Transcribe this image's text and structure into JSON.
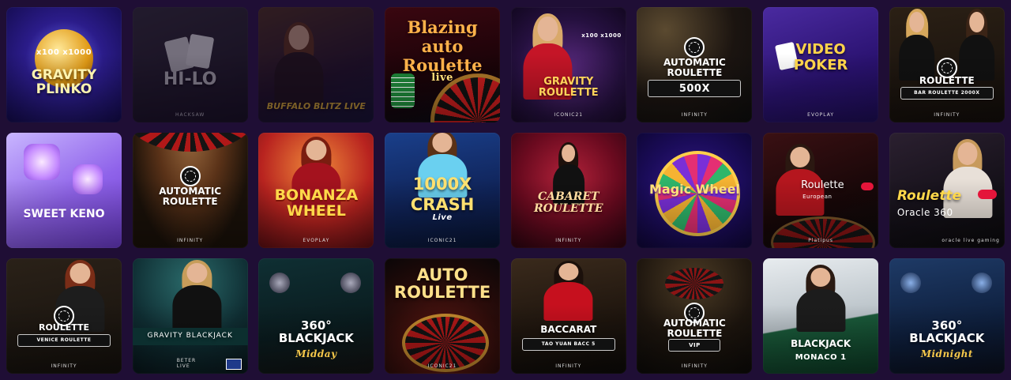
{
  "tiles": [
    {
      "title": "GRAVITY PLINKO",
      "subtitle": "x100  x1000",
      "provider": ""
    },
    {
      "title": "HI-LO",
      "subtitle": "",
      "provider": "HACKSAW"
    },
    {
      "title": "BUFFALO BLITZ LIVE",
      "subtitle": "",
      "provider": ""
    },
    {
      "title": "Blazing auto Roulette",
      "subtitle": "live",
      "provider": ""
    },
    {
      "title": "GRAVITY ROULETTE",
      "subtitle": "x100  x1000",
      "provider": "ICONIC21"
    },
    {
      "title": "AUTOMATIC ROULETTE",
      "subtitle": "500X",
      "provider": "INFINITY"
    },
    {
      "title": "VIDEO POKER",
      "subtitle": "",
      "provider": "EVOPLAY"
    },
    {
      "title": "ROULETTE",
      "subtitle": "BAR ROULETTE 2000X",
      "provider": "INFINITY"
    },
    {
      "title": "SWEET KENO",
      "subtitle": "",
      "provider": ""
    },
    {
      "title": "AUTOMATIC ROULETTE",
      "subtitle": "",
      "provider": "INFINITY"
    },
    {
      "title": "BONANZA WHEEL",
      "subtitle": "",
      "provider": "EVOPLAY"
    },
    {
      "title": "1000X CRASH",
      "subtitle": "Live",
      "provider": "ICONIC21"
    },
    {
      "title": "CABARET ROULETTE",
      "subtitle": "",
      "provider": "INFINITY"
    },
    {
      "title": "Magic Wheel",
      "subtitle": "",
      "provider": ""
    },
    {
      "title": "Roulette",
      "subtitle": "European",
      "provider": "Platipus"
    },
    {
      "title": "Roulette",
      "subtitle": "Oracle 360",
      "provider": "oracle live gaming"
    },
    {
      "title": "ROULETTE",
      "subtitle": "VENICE  ROULETTE",
      "provider": "INFINITY"
    },
    {
      "title": "GRAVITY BLACKJACK",
      "subtitle": "",
      "provider": "BETER LIVE"
    },
    {
      "title": "360° BLACKJACK",
      "subtitle": "Midday",
      "provider": ""
    },
    {
      "title": "AUTO ROULETTE",
      "subtitle": "",
      "provider": "ICONIC21"
    },
    {
      "title": "BACCARAT",
      "subtitle": "TAO YUAN  BACC 5",
      "provider": "INFINITY"
    },
    {
      "title": "AUTOMATIC ROULETTE",
      "subtitle": "VIP",
      "provider": "INFINITY"
    },
    {
      "title": "BLACKJACK",
      "subtitle": "MONACO 1",
      "provider": ""
    },
    {
      "title": "360° BLACKJACK",
      "subtitle": "Midnight",
      "provider": ""
    }
  ],
  "colors": {
    "page_bg": "#1f0e35",
    "gold": "#f2b530",
    "live_red": "#e4153a"
  }
}
